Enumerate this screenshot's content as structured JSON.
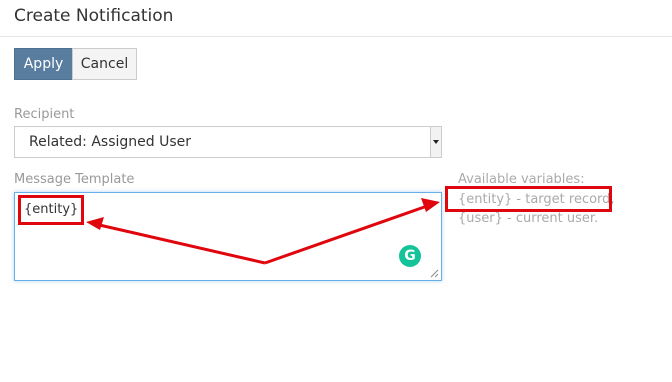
{
  "header": {
    "title": "Create Notification"
  },
  "toolbar": {
    "apply_label": "Apply",
    "cancel_label": "Cancel"
  },
  "form": {
    "recipient": {
      "label": "Recipient",
      "selected_value": "Related: Assigned User"
    },
    "message_template": {
      "label": "Message Template",
      "value": "{entity}"
    },
    "help": {
      "title": "Available variables:",
      "entity_line": "{entity} - target record,",
      "user_line": "{user} - current user."
    }
  },
  "widgets": {
    "grammarly_letter": "G"
  },
  "colors": {
    "apply_button": "#587d9f",
    "annotation": "#e0060d",
    "grammarly": "#15c39a",
    "focus_border": "#66afe9"
  },
  "icons": [
    "dropdown-arrow-icon",
    "grammarly-icon",
    "resize-handle-icon",
    "annotation-arrow-icon"
  ]
}
